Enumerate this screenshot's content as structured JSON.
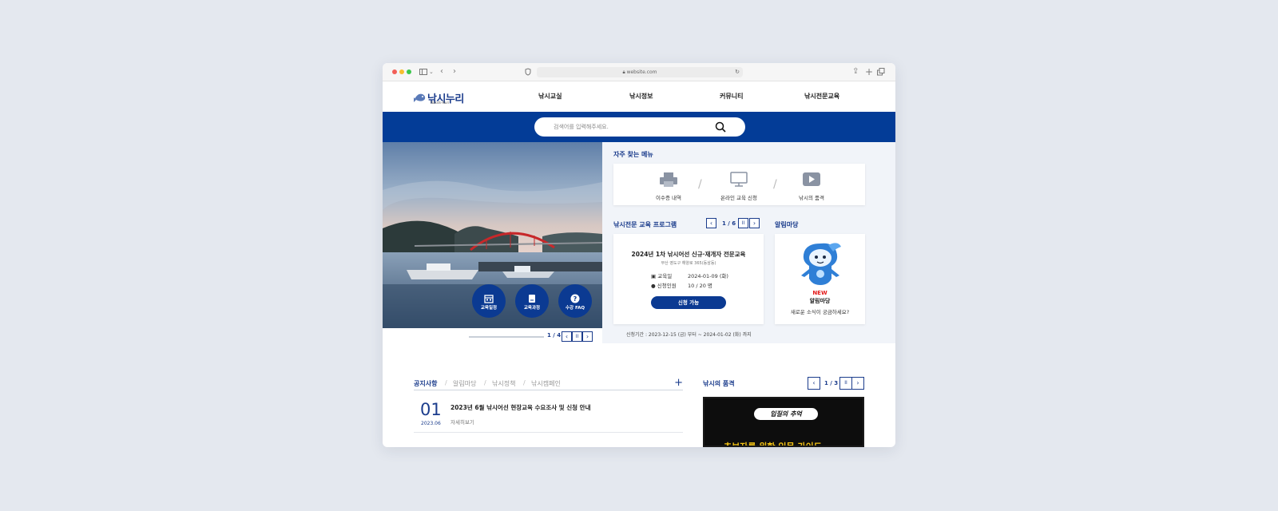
{
  "browser": {
    "url": "website.com"
  },
  "header": {
    "logo_text": "낚시누리",
    "logo_sub": "Nakshi-Nuri",
    "nav": [
      "낚시교실",
      "낚시정보",
      "커뮤니티",
      "낚시전문교육"
    ]
  },
  "search": {
    "placeholder": "검색어를 입력해주세요."
  },
  "hero": {
    "buttons": [
      "교육일정",
      "교육과정",
      "수강 FAQ"
    ],
    "pager": "1 / 4"
  },
  "quick_menu": {
    "title": "자주 찾는 메뉴",
    "items": [
      "이수증 내역",
      "온라인 교육 신청",
      "낚시의 품격"
    ]
  },
  "program": {
    "title": "낚시전문 교육 프로그램",
    "pager": "1 / 6",
    "card": {
      "title": "2024년 1차 낚시어선 신규·재개자 전문교육",
      "location": "부산 영도구 해양로 365(동삼동)",
      "edu_date_label": "교육일",
      "edu_date": "2024-01-09 (화)",
      "applicants_label": "신청인원",
      "applicants": "10 / 20 명",
      "button": "신청 가능"
    },
    "period": "신청기간 : 2023-12-15 (금) 부터 ~ 2024-01-02 (화) 까지"
  },
  "notice_board": {
    "title": "알림마당",
    "badge": "NEW",
    "card_title": "알림마당",
    "desc": "새로운 소식이 궁금하세요?"
  },
  "news": {
    "tabs": [
      "공지사항",
      "알림마당",
      "낚시정책",
      "낚시캠페인"
    ],
    "items": [
      {
        "num": "01",
        "date": "2023.06",
        "title": "2023년 6월 낚시어선 현장교육 수요조사 및 신청 안내",
        "more": "자세히보기"
      }
    ]
  },
  "video": {
    "title": "낚시의 품격",
    "pager": "1 / 3",
    "pill_text": "입질의 추억",
    "yellow_text": "초보자를 위한 입문 가이드"
  }
}
